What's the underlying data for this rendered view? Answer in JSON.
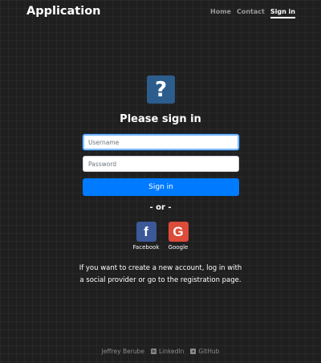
{
  "header": {
    "app_title": "Application",
    "nav": [
      {
        "label": "Home"
      },
      {
        "label": "Contact"
      },
      {
        "label": "Sign in",
        "active": true
      }
    ]
  },
  "login": {
    "logo_icon": "question-mark-icon",
    "logo_glyph": "?",
    "heading": "Please sign in",
    "username_placeholder": "Username",
    "password_placeholder": "Password",
    "signin_label": "Sign in",
    "or_text": "- or -",
    "social": [
      {
        "name": "facebook",
        "glyph": "f",
        "label": "Facebook"
      },
      {
        "name": "google",
        "glyph": "G",
        "label": "Google"
      }
    ],
    "info_line1": "If you want to create a new account, log in with",
    "info_line2": "a social provider or go to the registration page."
  },
  "footer": {
    "author": "Jeffrey Berube",
    "linkedin_label": "LinkedIn",
    "github_label": "GitHub"
  },
  "colors": {
    "background": "#1f1f1f",
    "primary": "#007bff",
    "logo_bg": "#2c5d8c",
    "facebook": "#3b5998",
    "google": "#dd4b39"
  }
}
